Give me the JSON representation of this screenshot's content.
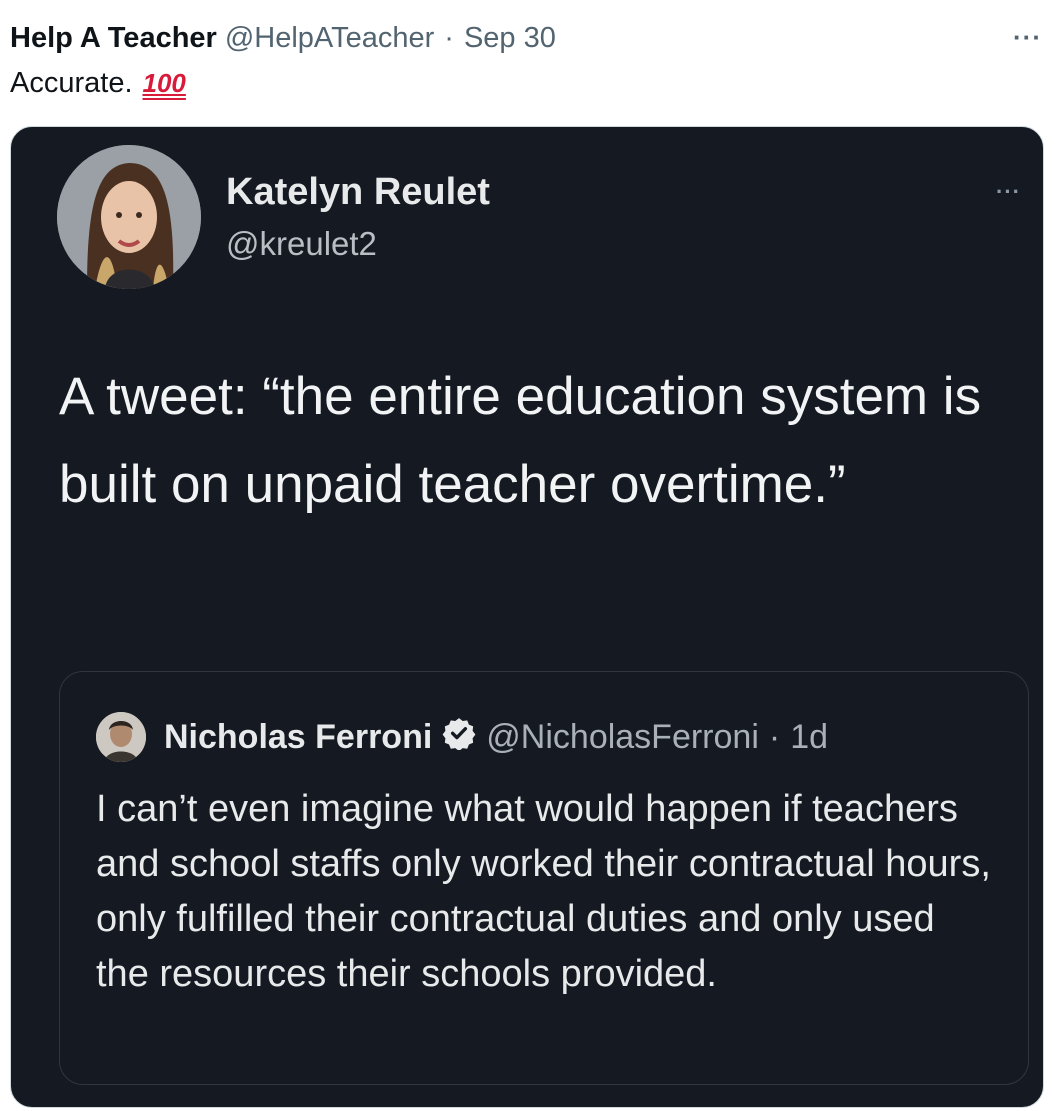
{
  "tweet": {
    "author_name": "Help A Teacher",
    "author_handle": "@HelpATeacher",
    "separator": "·",
    "date": "Sep 30",
    "more_label": "···",
    "text": "Accurate.",
    "emoji": "100",
    "emoji_icon": "hundred-points-emoji"
  },
  "image": {
    "background": "#151a22",
    "author_name": "Katelyn Reulet",
    "author_handle": "@kreulet2",
    "more_label": "···",
    "text": "A tweet: “the entire education system is built on unpaid teacher overtime.”",
    "quoted": {
      "author_name": "Nicholas Ferroni",
      "author_handle": "@NicholasFerroni",
      "separator": "·",
      "time": "1d",
      "verified_icon": "verified-badge-icon",
      "text": "I can’t even imagine what would happen if teachers and school staffs only worked their contractual hours, only fulfilled their contractual duties and only used the resources their schools provided."
    }
  }
}
